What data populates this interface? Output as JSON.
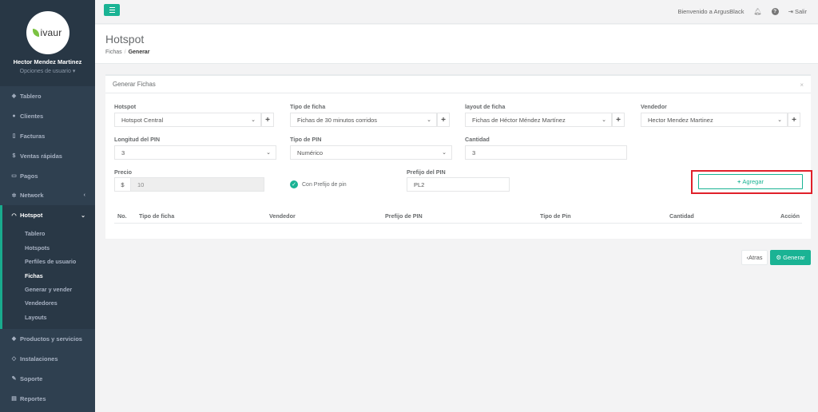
{
  "brand": {
    "logo_text": "ivaur",
    "accent": "#1ab394",
    "sidebar_bg": "#2f4050"
  },
  "user": {
    "name": "Hector Mendez Martinez",
    "options": "Opciones de usuario"
  },
  "nav": {
    "tablero": "Tablero",
    "clientes": "Clientes",
    "facturas": "Facturas",
    "ventas": "Ventas rápidas",
    "pagos": "Pagos",
    "network": "Network",
    "hotspot": "Hotspot",
    "productos": "Productos y servicios",
    "instalaciones": "Instalaciones",
    "soporte": "Soporte",
    "reportes": "Reportes"
  },
  "hotspot_sub": [
    "Tablero",
    "Hotspots",
    "Perfiles de usuario",
    "Fichas",
    "Generar y vender",
    "Vendedores",
    "Layouts"
  ],
  "topbar": {
    "welcome": "Bienvenido a ArgusBlack",
    "logout": "Salir"
  },
  "page": {
    "title": "Hotspot",
    "crumb1": "Fichas",
    "crumb2": "Generar"
  },
  "panel": {
    "title": "Generar Fichas",
    "hotspot_label": "Hotspot",
    "hotspot_value": "Hotspot Central",
    "tipo_label": "Tipo de ficha",
    "tipo_value": "Fichas de 30 minutos corridos",
    "layout_label": "layout de ficha",
    "layout_value": "Fichas de Héctor Méndez Martínez",
    "vendedor_label": "Vendedor",
    "vendedor_value": "Hector Mendez Martinez",
    "longitud_label": "Longitud del PIN",
    "longitud_value": "3",
    "tipopin_label": "Tipo de PIN",
    "tipopin_value": "Numérico",
    "cantidad_label": "Cantidad",
    "cantidad_value": "3",
    "precio_label": "Precio",
    "precio_prefix": "$",
    "precio_value": "10",
    "prefijo_check": "Con Prefijo de pin",
    "prefijo_label": "Prefijo del PIN",
    "prefijo_value": "PL2",
    "agregar": "Agregar"
  },
  "table": {
    "headers": [
      "No.",
      "Tipo de ficha",
      "Vendedor",
      "Prefijo de PIN",
      "Tipo de Pin",
      "Cantidad",
      "Acción"
    ]
  },
  "actions": {
    "back": "Atras",
    "generate": "Generar"
  }
}
